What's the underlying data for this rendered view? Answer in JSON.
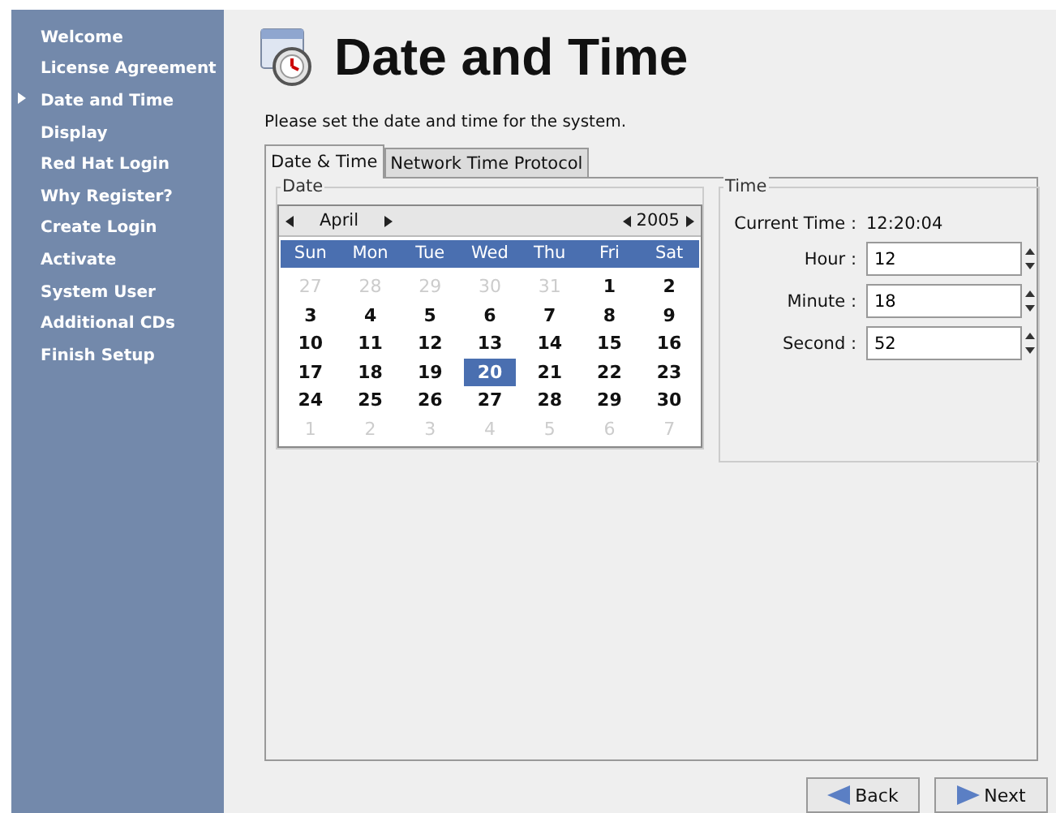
{
  "sidebar": {
    "items": [
      {
        "label": "Welcome",
        "selected": false
      },
      {
        "label": "License Agreement",
        "selected": false
      },
      {
        "label": "Date and Time",
        "selected": true
      },
      {
        "label": "Display",
        "selected": false
      },
      {
        "label": "Red Hat Login",
        "selected": false
      },
      {
        "label": "Why Register?",
        "selected": false
      },
      {
        "label": "Create Login",
        "selected": false
      },
      {
        "label": "Activate",
        "selected": false
      },
      {
        "label": "System User",
        "selected": false
      },
      {
        "label": "Additional CDs",
        "selected": false
      },
      {
        "label": "Finish Setup",
        "selected": false
      }
    ]
  },
  "header": {
    "title": "Date and Time",
    "subtitle": "Please set the date and time for the system."
  },
  "tabs": [
    {
      "label": "Date & Time",
      "selected": true
    },
    {
      "label": "Network Time Protocol",
      "selected": false
    }
  ],
  "date": {
    "legend": "Date",
    "month": "April",
    "year": "2005",
    "weekdays": [
      "Sun",
      "Mon",
      "Tue",
      "Wed",
      "Thu",
      "Fri",
      "Sat"
    ],
    "weeks": [
      [
        {
          "day": "27",
          "in_month": false,
          "selected": false
        },
        {
          "day": "28",
          "in_month": false,
          "selected": false
        },
        {
          "day": "29",
          "in_month": false,
          "selected": false
        },
        {
          "day": "30",
          "in_month": false,
          "selected": false
        },
        {
          "day": "31",
          "in_month": false,
          "selected": false
        },
        {
          "day": "1",
          "in_month": true,
          "selected": false
        },
        {
          "day": "2",
          "in_month": true,
          "selected": false
        }
      ],
      [
        {
          "day": "3",
          "in_month": true,
          "selected": false
        },
        {
          "day": "4",
          "in_month": true,
          "selected": false
        },
        {
          "day": "5",
          "in_month": true,
          "selected": false
        },
        {
          "day": "6",
          "in_month": true,
          "selected": false
        },
        {
          "day": "7",
          "in_month": true,
          "selected": false
        },
        {
          "day": "8",
          "in_month": true,
          "selected": false
        },
        {
          "day": "9",
          "in_month": true,
          "selected": false
        }
      ],
      [
        {
          "day": "10",
          "in_month": true,
          "selected": false
        },
        {
          "day": "11",
          "in_month": true,
          "selected": false
        },
        {
          "day": "12",
          "in_month": true,
          "selected": false
        },
        {
          "day": "13",
          "in_month": true,
          "selected": false
        },
        {
          "day": "14",
          "in_month": true,
          "selected": false
        },
        {
          "day": "15",
          "in_month": true,
          "selected": false
        },
        {
          "day": "16",
          "in_month": true,
          "selected": false
        }
      ],
      [
        {
          "day": "17",
          "in_month": true,
          "selected": false
        },
        {
          "day": "18",
          "in_month": true,
          "selected": false
        },
        {
          "day": "19",
          "in_month": true,
          "selected": false
        },
        {
          "day": "20",
          "in_month": true,
          "selected": true
        },
        {
          "day": "21",
          "in_month": true,
          "selected": false
        },
        {
          "day": "22",
          "in_month": true,
          "selected": false
        },
        {
          "day": "23",
          "in_month": true,
          "selected": false
        }
      ],
      [
        {
          "day": "24",
          "in_month": true,
          "selected": false
        },
        {
          "day": "25",
          "in_month": true,
          "selected": false
        },
        {
          "day": "26",
          "in_month": true,
          "selected": false
        },
        {
          "day": "27",
          "in_month": true,
          "selected": false
        },
        {
          "day": "28",
          "in_month": true,
          "selected": false
        },
        {
          "day": "29",
          "in_month": true,
          "selected": false
        },
        {
          "day": "30",
          "in_month": true,
          "selected": false
        }
      ],
      [
        {
          "day": "1",
          "in_month": false,
          "selected": false
        },
        {
          "day": "2",
          "in_month": false,
          "selected": false
        },
        {
          "day": "3",
          "in_month": false,
          "selected": false
        },
        {
          "day": "4",
          "in_month": false,
          "selected": false
        },
        {
          "day": "5",
          "in_month": false,
          "selected": false
        },
        {
          "day": "6",
          "in_month": false,
          "selected": false
        },
        {
          "day": "7",
          "in_month": false,
          "selected": false
        }
      ]
    ]
  },
  "time": {
    "legend": "Time",
    "current_label": "Current Time :",
    "current_value": "12:20:04",
    "fields": [
      {
        "label": "Hour :",
        "value": "12"
      },
      {
        "label": "Minute :",
        "value": "18"
      },
      {
        "label": "Second :",
        "value": "52"
      }
    ]
  },
  "buttons": [
    {
      "label": "Back",
      "kind": "back"
    },
    {
      "label": "Next",
      "kind": "next"
    }
  ]
}
